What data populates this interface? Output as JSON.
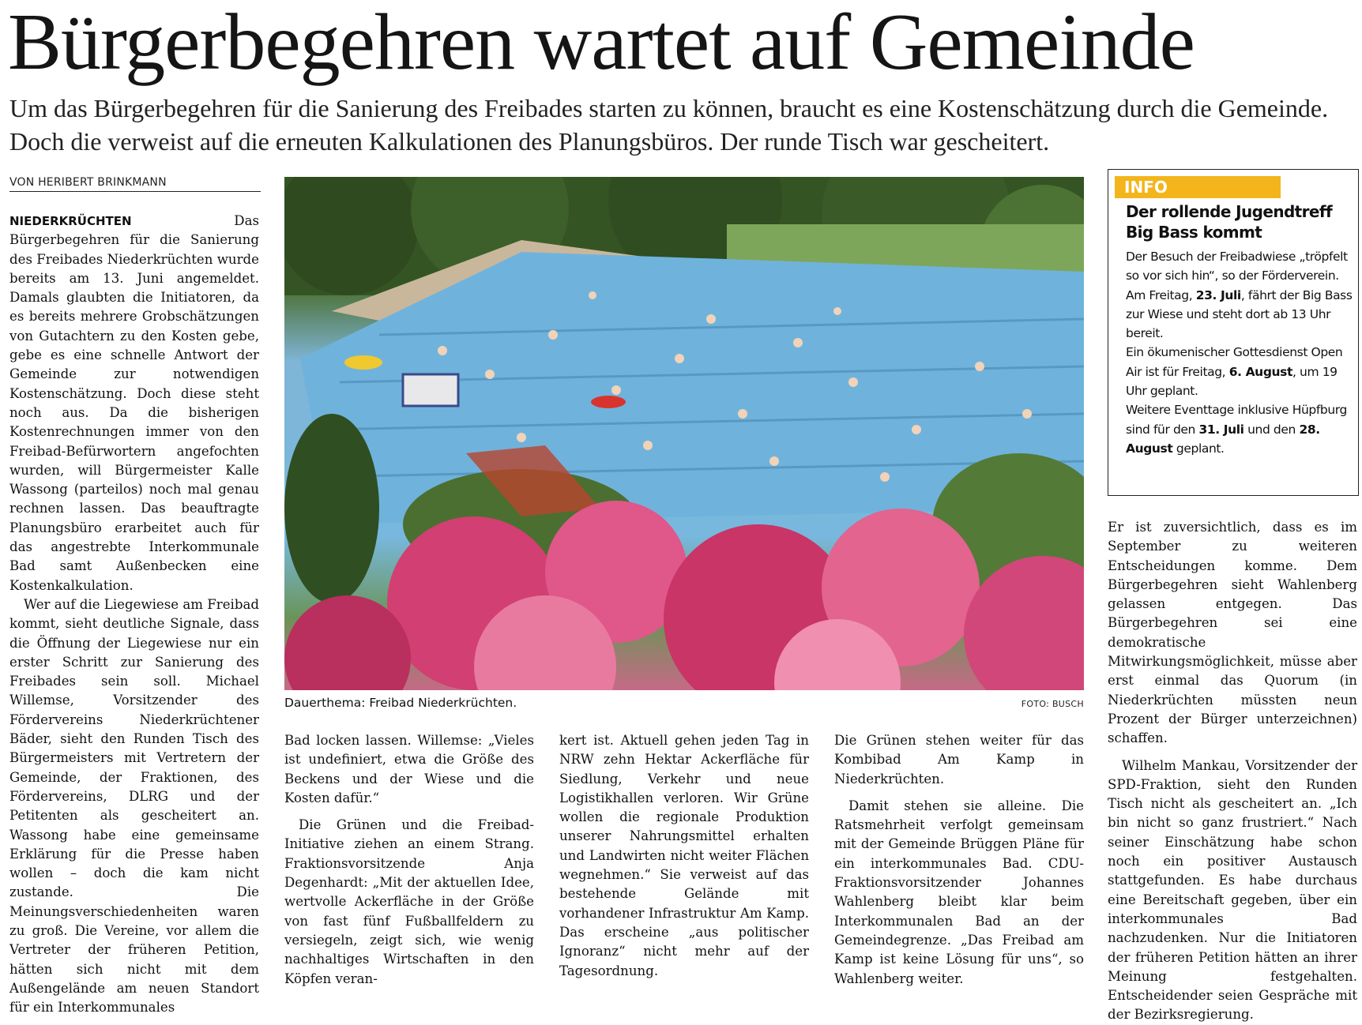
{
  "headline": "Bürgerbegehren wartet auf Gemeinde",
  "deck": "Um das Bürgerbegehren für die Sanierung des Freibades starten zu können, braucht es eine Kostenschätzung durch die Gemeinde. Doch die verweist auf die erneuten Kalkulationen des Planungsbüros. Der runde Tisch war gescheitert.",
  "byline": "VON HERIBERT BRINKMANN",
  "dateline": "NIEDERKRÜCHTEN",
  "photo": {
    "caption": "Dauerthema: Freibad Niederkrüchten.",
    "credit": "FOTO: BUSCH"
  },
  "info": {
    "label": "INFO",
    "title": "Der rollende Jugendtreff Big Bass kommt",
    "p1": "Der Besuch der Freibadwiese „tröpfelt so vor sich hin“, so der Förderverein.",
    "p2_a": "Am Freitag, ",
    "p2_b": "23. Juli",
    "p2_c": ", fährt der Big Bass zur Wiese und steht dort ab 13 Uhr bereit.",
    "p3_a": "Ein ökumenischer Gottesdienst Open Air ist für Freitag, ",
    "p3_b": "6. August",
    "p3_c": ", um 19 Uhr geplant.",
    "p4_a": "Weitere Eventtage inklusive Hüpfburg sind für den ",
    "p4_b": "31. Juli",
    "p4_c": " und den ",
    "p4_d": "28. August",
    "p4_e": " geplant."
  },
  "columns": {
    "c1_p1": " Das Bürgerbegehren für die Sanierung des Freibades Niederkrüchten wurde bereits am 13. Juni angemeldet. Damals glaubten die Initiatoren, da es bereits mehrere Grobschätzungen von Gutachtern zu den Kosten gebe, gebe es eine schnelle Antwort der Gemeinde zur notwendigen Kostenschätzung. Doch diese steht noch aus. Da die bisherigen Kostenrechnungen immer von den Freibad-Befürwortern angefochten wurden, will Bürgermeister Kalle Wassong (parteilos) noch mal genau rechnen lassen. Das beauftragte Planungsbüro erarbeitet auch für das angestrebte Interkommunale Bad samt Außenbecken eine Kostenkalkulation.",
    "c1_p2": "Wer auf die Liegewiese am Freibad kommt, sieht deutliche Signale, dass die Öffnung der Liegewiese nur ein erster Schritt zur Sanierung des Freibades sein soll. Michael Willemse, Vorsitzender des Fördervereins Niederkrüchtener Bäder, sieht den Runden Tisch des Bürgermeisters mit Vertretern der Gemeinde, der Fraktionen, des Fördervereins, DLRG und der Petitenten als gescheitert an. Wassong habe eine gemeinsame Erklärung für die Presse haben wollen – doch die kam nicht zustande. Die Meinungsverschiedenheiten waren zu groß. Die Vereine, vor allem die Vertreter der früheren Petition, hätten sich nicht mit dem Außengelände am neuen Standort für ein Interkommunales",
    "c2_p1": "Bad locken lassen. Willemse: „Vieles ist undefiniert, etwa die Größe des Beckens und der Wiese und die Kosten dafür.“",
    "c2_p2": "Die Grünen und die Freibad-Initiative ziehen an einem Strang. Fraktionsvorsitzende Anja Degenhardt: „Mit der aktuellen Idee, wertvolle Ackerfläche in der Größe von fast fünf Fußballfeldern zu versiegeln, zeigt sich, wie wenig nachhaltiges Wirtschaften in den Köpfen veran-",
    "c3_p1": "kert ist. Aktuell gehen jeden Tag in NRW zehn Hektar Ackerfläche für Siedlung, Verkehr und neue Logistikhallen verloren. Wir Grüne wollen die regionale Produktion unserer Nahrungsmittel erhalten und Landwirten nicht weiter Flächen wegnehmen.“ Sie verweist auf das bestehende Gelände mit vorhandener Infrastruktur Am Kamp. Das erscheine „aus politischer Ignoranz“ nicht mehr auf der Tagesordnung.",
    "c4_p1": "Die Grünen stehen weiter für das Kombibad Am Kamp in Niederkrüchten.",
    "c4_p2": "Damit stehen sie alleine. Die Ratsmehrheit verfolgt gemeinsam mit der Gemeinde Brüggen Pläne für ein interkommunales Bad. CDU-Fraktionsvorsitzender Johannes Wahlenberg bleibt klar beim Interkommunalen Bad an der Gemeindegrenze. „Das Freibad am Kamp ist keine Lösung für uns“, so Wahlenberg weiter.",
    "c5_p1": "Er ist zuversichtlich, dass es im September zu weiteren Entscheidungen komme. Dem Bürgerbegehren sieht Wahlenberg gelassen entgegen. Das Bürgerbegehren sei eine demokratische Mitwirkungsmöglichkeit, müsse aber erst einmal das Quorum (in Niederkrüchten müssten neun Prozent der Bürger unterzeichnen) schaffen.",
    "c5_p2": "Wilhelm Mankau, Vorsitzender der SPD-Fraktion, sieht den Runden Tisch nicht als gescheitert an. „Ich bin nicht so ganz frustriert.“ Nach seiner Einschätzung habe schon noch ein positiver Austausch stattgefunden. Es habe durchaus eine Bereitschaft gegeben, über ein interkommunales Bad nachzudenken. Nur die Initiatoren der früheren Petition hätten an ihrer Meinung festgehalten. Entscheidender seien Gespräche mit der Bezirksregierung."
  },
  "colors": {
    "info_accent": "#f3b51b",
    "text": "#111111"
  }
}
